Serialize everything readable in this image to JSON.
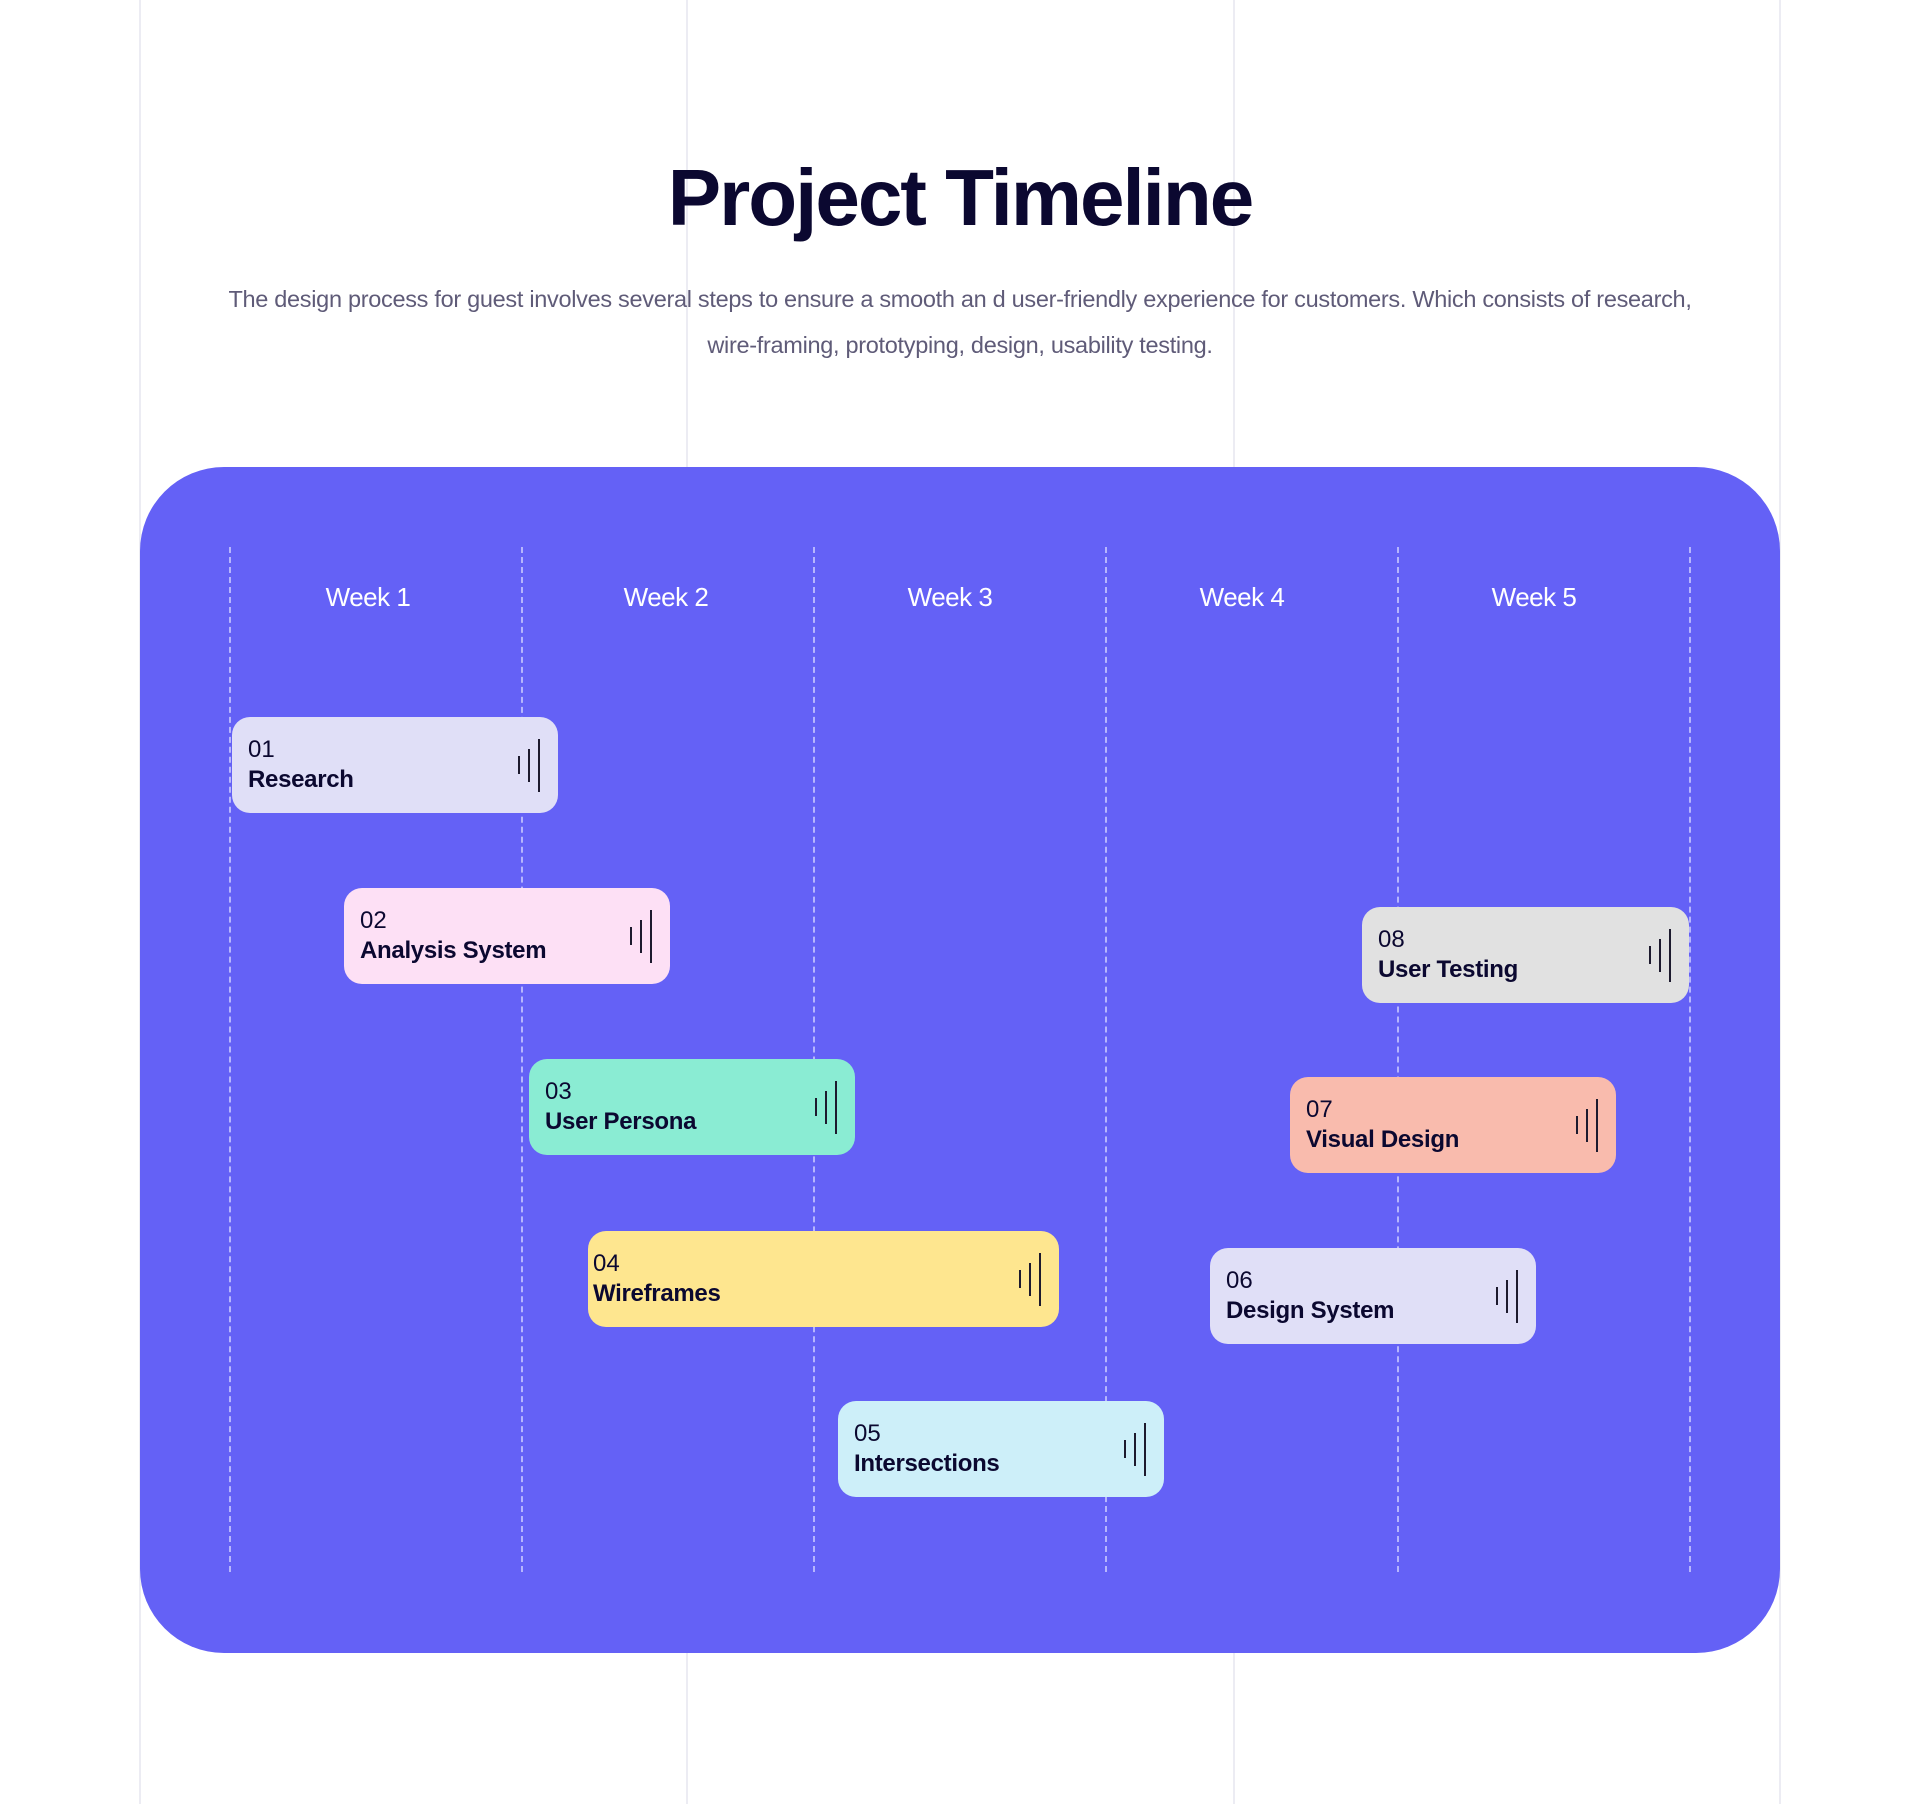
{
  "header": {
    "title": "Project Timeline",
    "subtitle_line1": "The design process for guest involves several steps to ensure a smooth an d user-friendly experience for customers. Which consists of research,",
    "subtitle_line2": "wire-framing, prototyping, design, usability testing."
  },
  "timeline": {
    "weeks": [
      "Week 1",
      "Week 2",
      "Week 3",
      "Week 4",
      "Week 5"
    ],
    "colors": {
      "panel": "#6461f6",
      "text": "#0b0830"
    },
    "tasks": [
      {
        "number": "01",
        "name": "Research",
        "color": "#e0dff7",
        "icon": "bars-icon"
      },
      {
        "number": "02",
        "name": "Analysis System",
        "color": "#fde0f5",
        "icon": "bars-icon"
      },
      {
        "number": "03",
        "name": "User Persona",
        "color": "#8aecd3",
        "icon": "bars-icon"
      },
      {
        "number": "04",
        "name": "Wireframes",
        "color": "#fee68f",
        "icon": "bars-icon"
      },
      {
        "number": "05",
        "name": "Intersections",
        "color": "#cdeff9",
        "icon": "bars-icon"
      },
      {
        "number": "06",
        "name": "Design System",
        "color": "#e0dff7",
        "icon": "bars-icon"
      },
      {
        "number": "07",
        "name": "Visual Design",
        "color": "#f9bbad",
        "icon": "bars-icon"
      },
      {
        "number": "08",
        "name": "User Testing",
        "color": "#e1e1e1",
        "icon": "bars-icon"
      }
    ]
  }
}
